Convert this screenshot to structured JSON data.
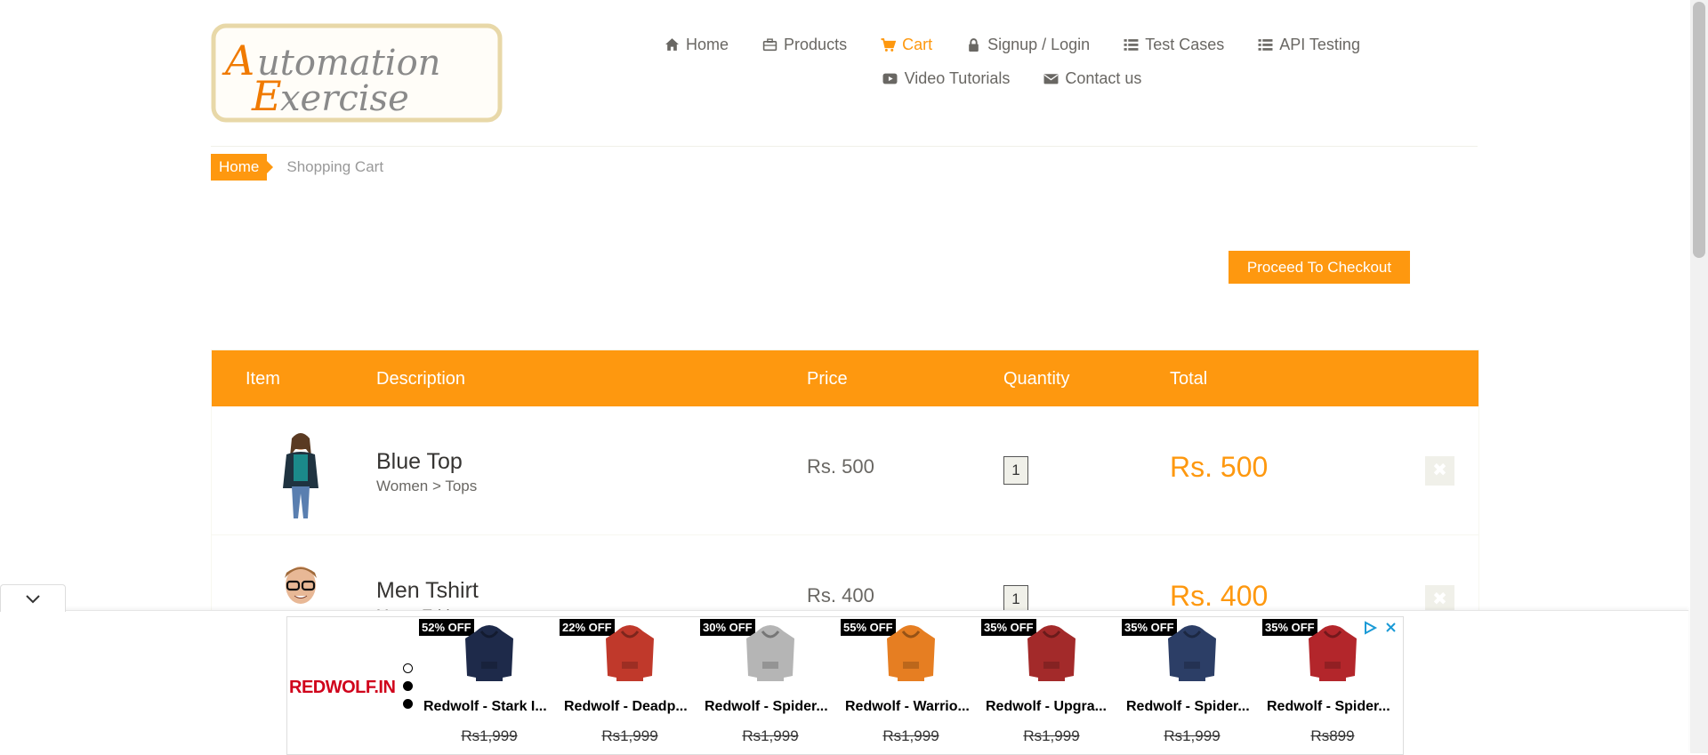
{
  "nav": {
    "items": [
      {
        "label": "Home",
        "icon": "home-icon",
        "active": false
      },
      {
        "label": "Products",
        "icon": "briefcase-icon",
        "active": false
      },
      {
        "label": "Cart",
        "icon": "cart-icon",
        "active": true
      },
      {
        "label": "Signup / Login",
        "icon": "lock-icon",
        "active": false
      },
      {
        "label": "Test Cases",
        "icon": "list-icon",
        "active": false
      },
      {
        "label": "API Testing",
        "icon": "list-icon",
        "active": false
      },
      {
        "label": "Video Tutorials",
        "icon": "youtube-icon",
        "active": false
      },
      {
        "label": "Contact us",
        "icon": "envelope-icon",
        "active": false
      }
    ]
  },
  "logo": {
    "line1": "Automation",
    "line2": "Exercise"
  },
  "breadcrumb": {
    "home": "Home",
    "current": "Shopping Cart"
  },
  "checkout": {
    "label": "Proceed To Checkout"
  },
  "table": {
    "headers": [
      "Item",
      "Description",
      "Price",
      "Quantity",
      "Total"
    ],
    "rows": [
      {
        "name": "Blue Top",
        "category": "Women > Tops",
        "price": "Rs. 500",
        "quantity": "1",
        "total": "Rs. 500"
      },
      {
        "name": "Men Tshirt",
        "category": "Men > Tshirts",
        "price": "Rs. 400",
        "quantity": "1",
        "total": "Rs. 400"
      }
    ]
  },
  "ad": {
    "brand": "REDWOLF.IN",
    "items": [
      {
        "badge": "52% OFF",
        "title": "Redwolf - Stark I...",
        "price": "Rs1,999",
        "color": "#1e2a4a"
      },
      {
        "badge": "22% OFF",
        "title": "Redwolf - Deadp...",
        "price": "Rs1,999",
        "color": "#c0392b"
      },
      {
        "badge": "30% OFF",
        "title": "Redwolf - Spider...",
        "price": "Rs1,999",
        "color": "#b5b5b5"
      },
      {
        "badge": "55% OFF",
        "title": "Redwolf - Warrio...",
        "price": "Rs1,999",
        "color": "#e67e22"
      },
      {
        "badge": "35% OFF",
        "title": "Redwolf - Upgra...",
        "price": "Rs1,999",
        "color": "#a32a2a"
      },
      {
        "badge": "35% OFF",
        "title": "Redwolf - Spider...",
        "price": "Rs1,999",
        "color": "#2c3e66"
      },
      {
        "badge": "35% OFF",
        "title": "Redwolf - Spider...",
        "price": "Rs899",
        "color": "#b3262b"
      }
    ]
  },
  "colors": {
    "accent": "#FE980F",
    "text": "#696763"
  }
}
